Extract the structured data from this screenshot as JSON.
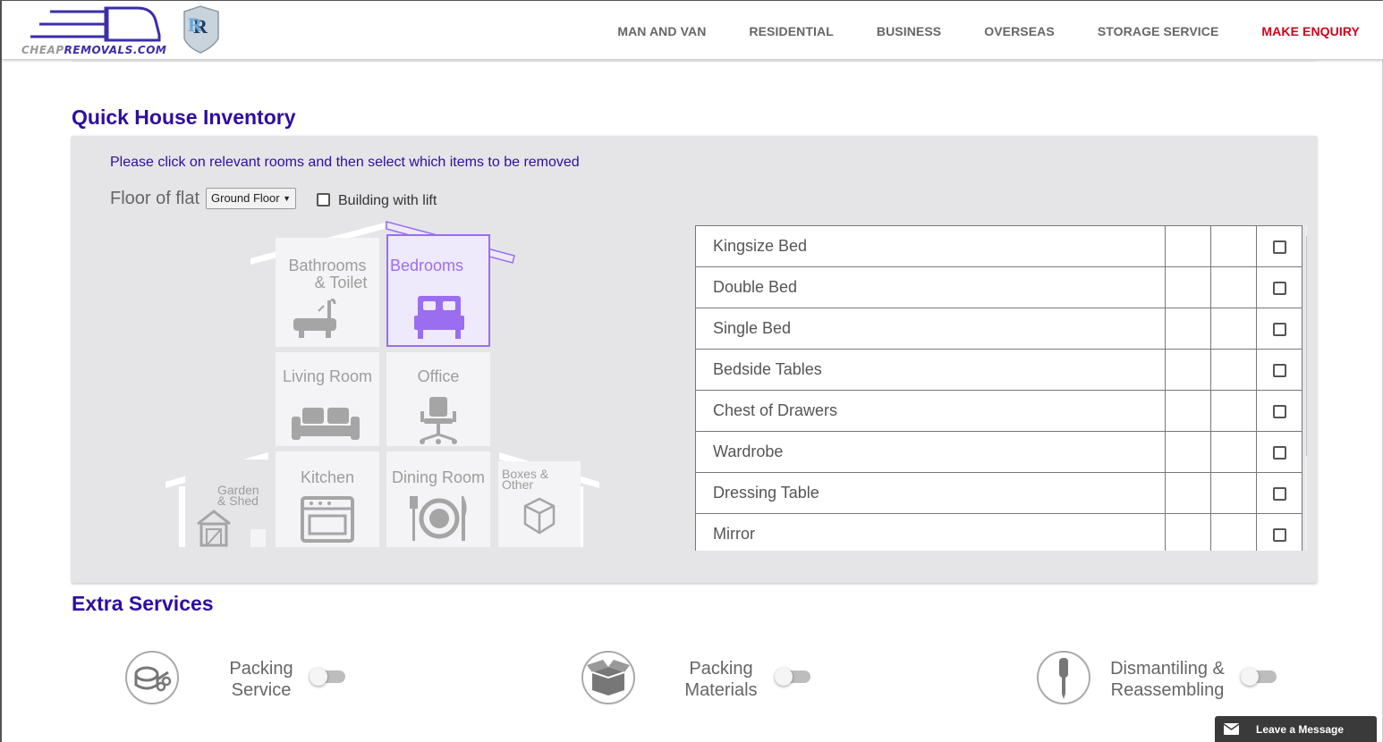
{
  "header": {
    "logo_cheap": "CHEAP",
    "logo_rest": "REMOVALS.COM",
    "nav": [
      "MAN AND VAN",
      "RESIDENTIAL",
      "BUSINESS",
      "OVERSEAS",
      "STORAGE SERVICE",
      "MAKE ENQUIRY"
    ]
  },
  "inventory": {
    "title": "Quick House Inventory",
    "instructions": "Please click on relevant rooms and then select which items to be removed",
    "floor_label": "Floor of flat",
    "floor_value": "Ground Floor",
    "lift_label": "Building with lift",
    "rooms": {
      "bathroom_1": "Bathrooms",
      "bathroom_2": "& Toilet",
      "bedrooms": "Bedrooms",
      "living": "Living Room",
      "office": "Office",
      "garden_1": "Garden",
      "garden_2": "& Shed",
      "kitchen": "Kitchen",
      "dining": "Dining Room",
      "boxes_1": "Boxes &",
      "boxes_2": "Other"
    },
    "active_room": "Bedrooms",
    "items": [
      "Kingsize Bed",
      "Double Bed",
      "Single Bed",
      "Bedside Tables",
      "Chest of Drawers",
      "Wardrobe",
      "Dressing Table",
      "Mirror"
    ]
  },
  "extra": {
    "title": "Extra Services",
    "services": [
      {
        "line1": "Packing",
        "line2": "Service",
        "icon": "tape-scissors-icon"
      },
      {
        "line1": "Packing",
        "line2": "Materials",
        "icon": "box-icon"
      },
      {
        "line1": "Dismantiling &",
        "line2": "Reassembling",
        "icon": "screwdriver-icon"
      }
    ]
  },
  "chat": {
    "label": "Leave a Message"
  },
  "colors": {
    "accent": "#2e0ea0",
    "active_room": "#9b6df0",
    "enquiry": "#d0021b"
  }
}
